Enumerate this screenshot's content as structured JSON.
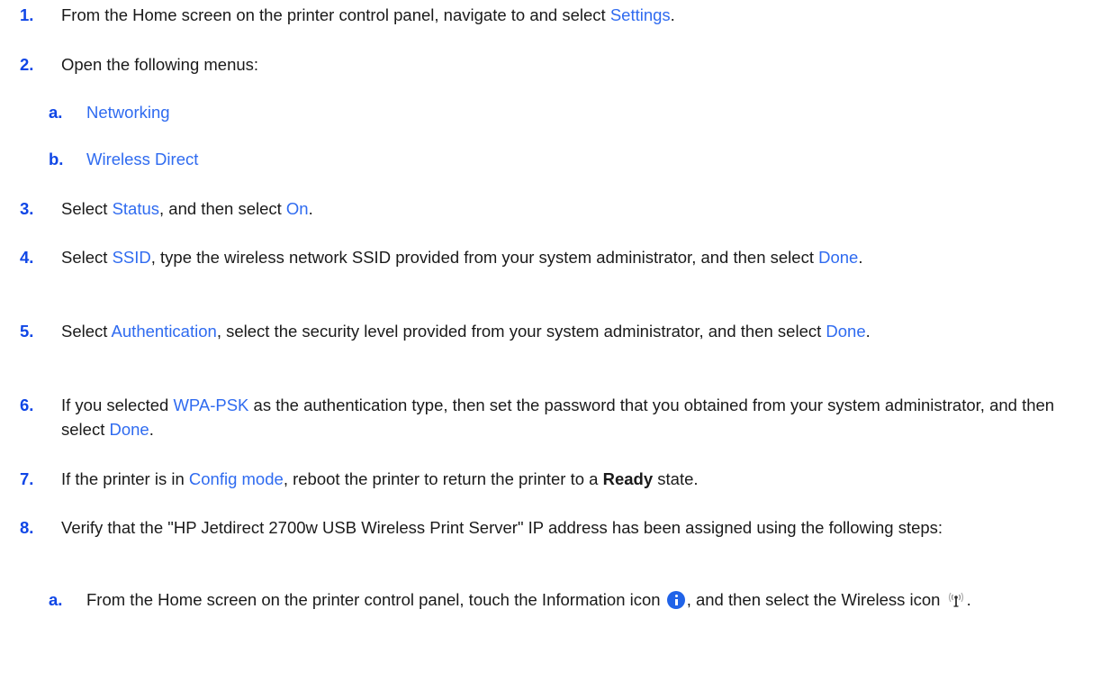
{
  "steps": [
    {
      "num": "1.",
      "parts": [
        "From the Home screen on the printer control panel, navigate to and select ",
        "Settings",
        "."
      ]
    },
    {
      "num": "2.",
      "parts": [
        "Open the following menus:"
      ]
    },
    {
      "num": "3.",
      "parts": [
        "Select ",
        "Status",
        ", and then select ",
        "On",
        "."
      ]
    },
    {
      "num": "4.",
      "parts": [
        "Select ",
        "SSID",
        ", type the wireless network SSID provided from your system administrator, and then select ",
        "Done",
        "."
      ]
    },
    {
      "num": "5.",
      "parts": [
        "Select ",
        "Authentication",
        ", select the security level provided from your system administrator, and then select ",
        "Done",
        "."
      ]
    },
    {
      "num": "6.",
      "parts": [
        "If you selected ",
        "WPA-PSK",
        " as the authentication type, then set the password that you obtained from your system administrator, and then select ",
        "Done",
        "."
      ]
    },
    {
      "num": "7.",
      "parts": [
        "If the printer is in ",
        "Config mode",
        ", reboot the printer to return the printer to a ",
        "Ready",
        " state."
      ]
    },
    {
      "num": "8.",
      "parts": [
        "Verify that the \"HP Jetdirect 2700w USB Wireless Print Server\" IP address has been assigned using the following steps:"
      ]
    }
  ],
  "substeps_2": [
    {
      "num": "a.",
      "label": "Networking"
    },
    {
      "num": "b.",
      "label": "Wireless Direct"
    }
  ],
  "substep_8a": {
    "num": "a.",
    "parts": [
      "From the Home screen on the printer control panel, touch the Information icon",
      ", and then select the Wireless icon",
      "."
    ]
  },
  "icons": {
    "information": "information-icon",
    "wireless": "wireless-icon"
  },
  "colors": {
    "step_number": "#0f46e6",
    "link": "#2f6bf0",
    "text": "#1a1a1a"
  }
}
